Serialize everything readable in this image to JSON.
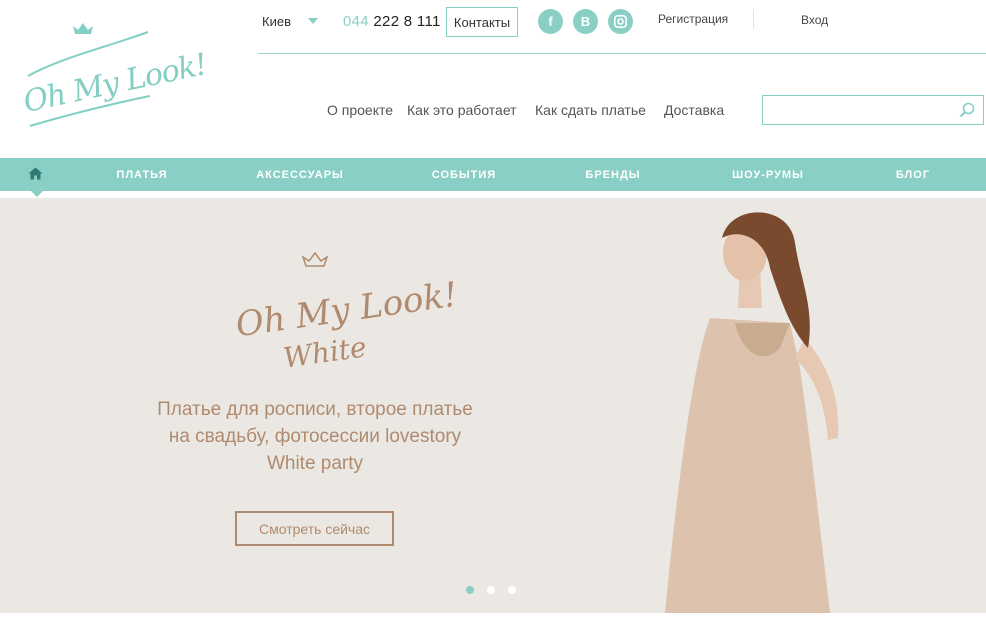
{
  "brand": {
    "logo_text": "Oh My Look!"
  },
  "header": {
    "city": "Киев",
    "phone_code": "044",
    "phone_number": "222 8 111",
    "contacts_label": "Контакты",
    "social": {
      "facebook": "f",
      "vk": "B",
      "instagram": "instagram-icon"
    },
    "register_label": "Регистрация",
    "login_label": "Вход"
  },
  "secondary_nav": {
    "items": [
      {
        "label": "О проекте"
      },
      {
        "label": "Как это работает"
      },
      {
        "label": "Как сдать платье"
      },
      {
        "label": "Доставка"
      }
    ]
  },
  "search": {
    "placeholder": "",
    "value": ""
  },
  "main_nav": {
    "home_icon": "home-icon",
    "items": [
      {
        "label": "ПЛАТЬЯ"
      },
      {
        "label": "АКСЕССУАРЫ"
      },
      {
        "label": "СОБЫТИЯ"
      },
      {
        "label": "БРЕНДЫ"
      },
      {
        "label": "ШОУ-РУМЫ"
      },
      {
        "label": "БЛОГ"
      }
    ]
  },
  "hero": {
    "logo_line1": "Oh My Look!",
    "logo_line2": "White",
    "tagline_lines": [
      "Платье для росписи, второе платье",
      "на свадьбу, фотосессии lovestory",
      "White party"
    ],
    "cta_label": "Смотреть сейчас",
    "slides_total": 3,
    "active_slide": 1
  },
  "colors": {
    "accent": "#8acfc6",
    "hero_bg": "#ebe8e3",
    "hero_text": "#b08a6e"
  }
}
